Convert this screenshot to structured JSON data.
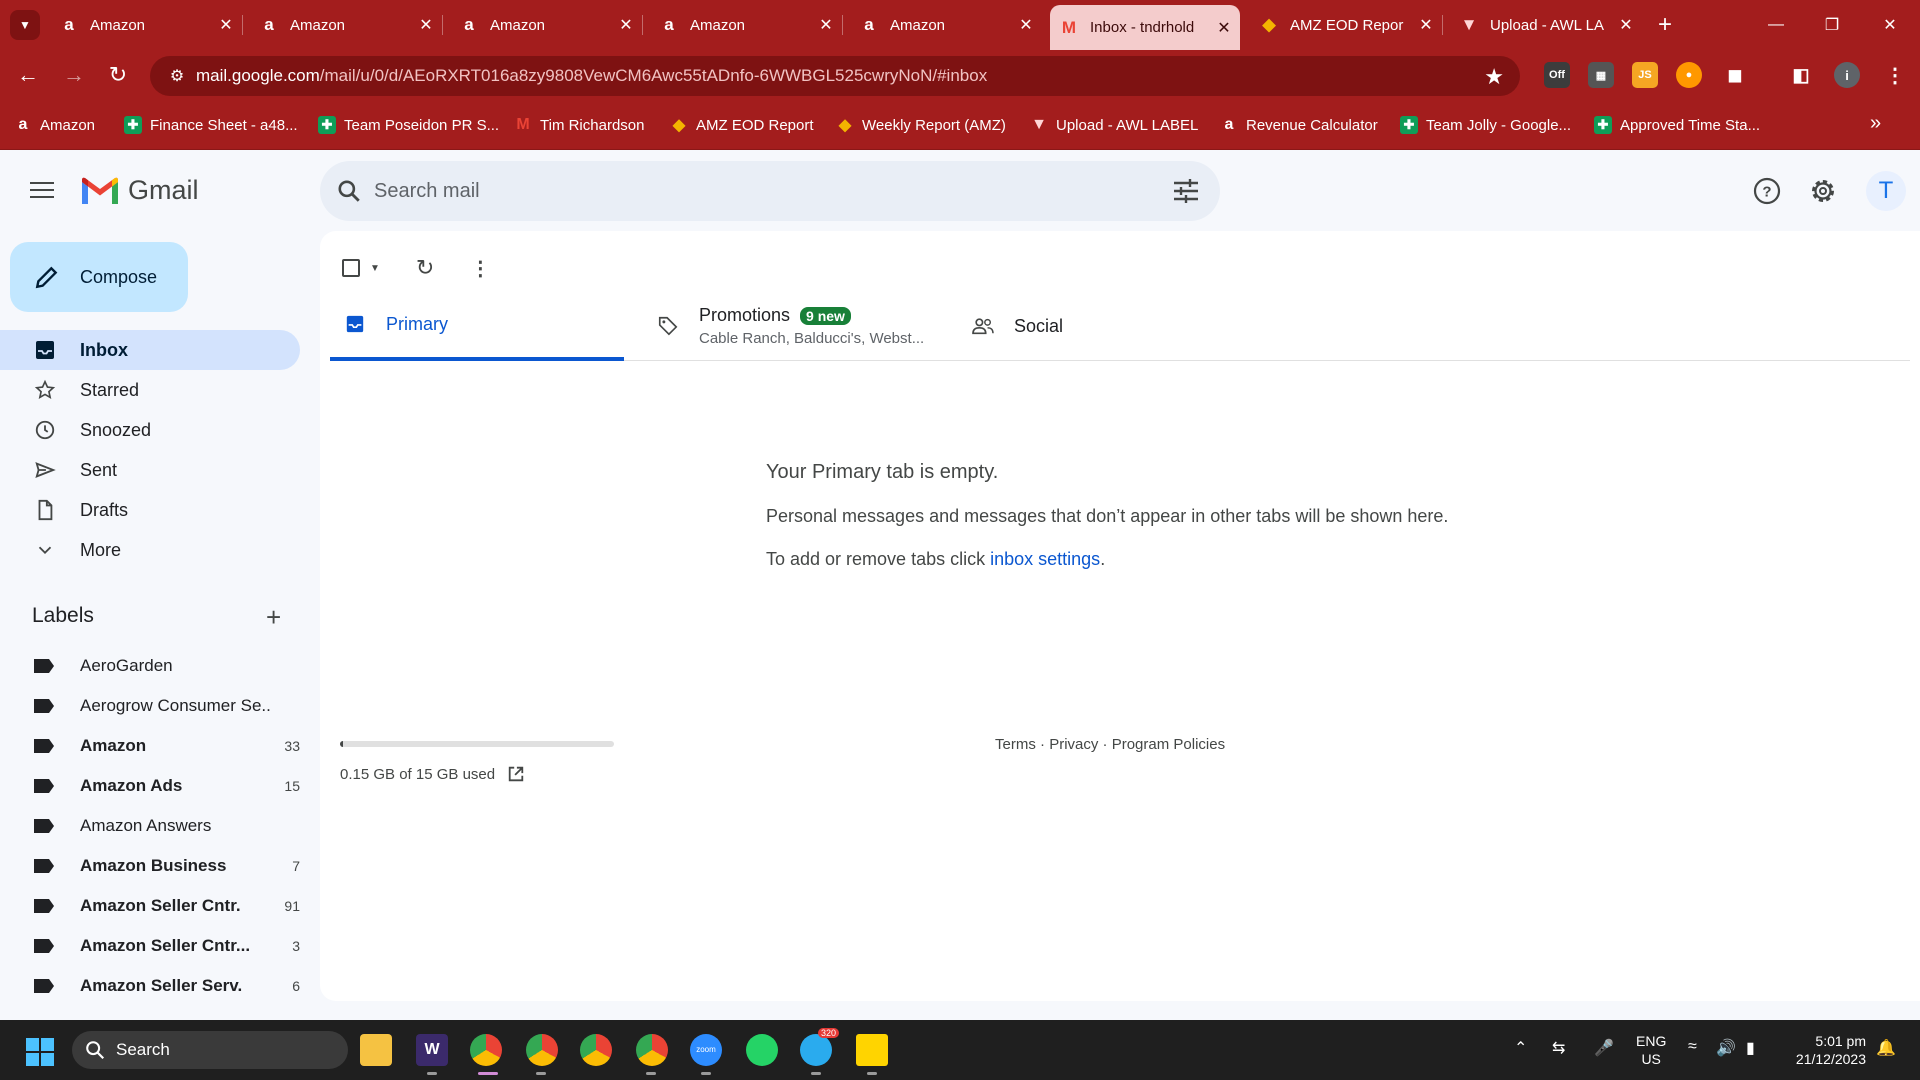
{
  "browser": {
    "tabs": [
      {
        "title": "Amazon",
        "icon": "amazon-icon"
      },
      {
        "title": "Amazon",
        "icon": "amazon-icon"
      },
      {
        "title": "Amazon",
        "icon": "amazon-icon"
      },
      {
        "title": "Amazon",
        "icon": "amazon-icon"
      },
      {
        "title": "Amazon",
        "icon": "amazon-icon"
      },
      {
        "title": "Inbox - tndrhold",
        "icon": "gmail-icon",
        "active": true
      },
      {
        "title": "AMZ EOD Repor",
        "icon": "eod-icon"
      },
      {
        "title": "Upload - AWL LA",
        "icon": "awl-icon"
      }
    ],
    "url_host": "mail.google.com",
    "url_path": "/mail/u/0/d/AEoRXRT016a8zy9808VewCM6Awc55tADnfo-6WWBGL525cwryNoN/#inbox",
    "bookmarks": [
      {
        "label": "Amazon",
        "icon": "amazon-icon"
      },
      {
        "label": "Finance Sheet - a48...",
        "icon": "sheets-icon"
      },
      {
        "label": "Team Poseidon PR S...",
        "icon": "sheets-icon"
      },
      {
        "label": "Tim Richardson",
        "icon": "gmail-icon"
      },
      {
        "label": "AMZ EOD Report",
        "icon": "eod-icon"
      },
      {
        "label": "Weekly Report (AMZ)",
        "icon": "eod-icon"
      },
      {
        "label": "Upload - AWL LABEL",
        "icon": "awl-icon"
      },
      {
        "label": "Revenue Calculator",
        "icon": "amazon-icon"
      },
      {
        "label": "Team Jolly - Google...",
        "icon": "sheets-icon"
      },
      {
        "label": "Approved Time Sta...",
        "icon": "sheets-icon"
      }
    ],
    "extension_off_label": "Off",
    "extension_js_label": "JS",
    "profile_letter": "i"
  },
  "gmail": {
    "product_name": "Gmail",
    "search_placeholder": "Search mail",
    "avatar_letter": "T",
    "compose_label": "Compose",
    "nav": [
      {
        "label": "Inbox",
        "icon": "inbox-icon",
        "active": true
      },
      {
        "label": "Starred",
        "icon": "star-icon"
      },
      {
        "label": "Snoozed",
        "icon": "clock-icon"
      },
      {
        "label": "Sent",
        "icon": "send-icon"
      },
      {
        "label": "Drafts",
        "icon": "draft-icon"
      },
      {
        "label": "More",
        "icon": "chevron-down-icon"
      }
    ],
    "labels_title": "Labels",
    "labels": [
      {
        "name": "AeroGarden",
        "count": "",
        "bold": false
      },
      {
        "name": "Aerogrow Consumer Se...",
        "count": "",
        "bold": false
      },
      {
        "name": "Amazon",
        "count": "33",
        "bold": true
      },
      {
        "name": "Amazon Ads",
        "count": "15",
        "bold": true
      },
      {
        "name": "Amazon Answers",
        "count": "",
        "bold": false
      },
      {
        "name": "Amazon Business",
        "count": "7",
        "bold": true
      },
      {
        "name": "Amazon Seller Cntr.",
        "count": "91",
        "bold": true
      },
      {
        "name": "Amazon Seller Cntr...",
        "count": "3",
        "bold": true
      },
      {
        "name": "Amazon Seller Serv.",
        "count": "6",
        "bold": true
      }
    ],
    "category_tabs": {
      "primary": "Primary",
      "promotions": "Promotions",
      "promotions_badge": "9 new",
      "promotions_senders": "Cable Ranch, Balducci's, Webst...",
      "social": "Social"
    },
    "empty_state": {
      "heading": "Your Primary tab is empty.",
      "body": "Personal messages and messages that don’t appear in other tabs will be shown here.",
      "settings_prefix": "To add or remove tabs click ",
      "settings_link": "inbox settings",
      "settings_suffix": "."
    },
    "storage": {
      "used_text": "0.15 GB of 15 GB used",
      "used_fraction": 0.01
    },
    "footer": {
      "terms": "Terms",
      "privacy": "Privacy",
      "policies": "Program Policies",
      "sep": "·"
    }
  },
  "taskbar": {
    "search_label": "Search",
    "telegram_badge": "320",
    "lang_line1": "ENG",
    "lang_line2": "US",
    "time": "5:01 pm",
    "date": "21/12/2023",
    "zoom_label": "zoom"
  },
  "colors": {
    "chrome": "#a31d1d",
    "omnibox": "#7e1212",
    "accent": "#0b57d0",
    "active_nav": "#d3e3fd",
    "compose": "#c2e7ff",
    "badge": "#188038"
  }
}
